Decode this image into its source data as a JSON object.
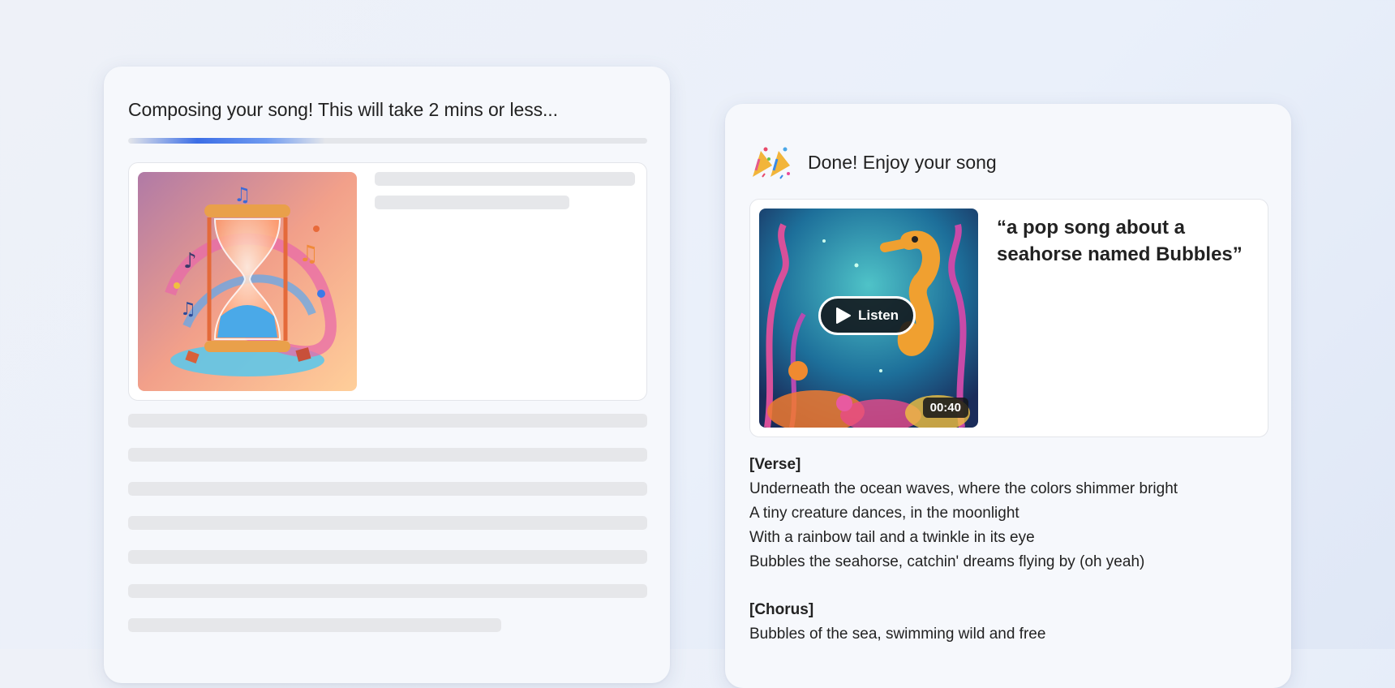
{
  "composing": {
    "status_text": "Composing your song! This will take 2 mins or less...",
    "progress": 0.38,
    "thumbnail_icon": "hourglass-music-art"
  },
  "result": {
    "done_text": "Done! Enjoy your song",
    "celebration_icon": "party-popper-icon",
    "prompt": "“a pop song about a seahorse named Bubbles”",
    "listen_label": "Listen",
    "duration": "00:40",
    "cover_icon": "seahorse-art",
    "lyrics": [
      {
        "section": "[Verse]",
        "lines": [
          "Underneath the ocean waves, where the colors shimmer bright",
          "A tiny creature dances, in the moonlight",
          "With a rainbow tail and a twinkle in its eye",
          "Bubbles the seahorse, catchin' dreams flying by (oh yeah)"
        ]
      },
      {
        "section": "[Chorus]",
        "lines": [
          "Bubbles of the sea, swimming wild and free"
        ]
      }
    ]
  },
  "colors": {
    "accent": "#3c6ee6",
    "skeleton": "#e6e7ea"
  }
}
